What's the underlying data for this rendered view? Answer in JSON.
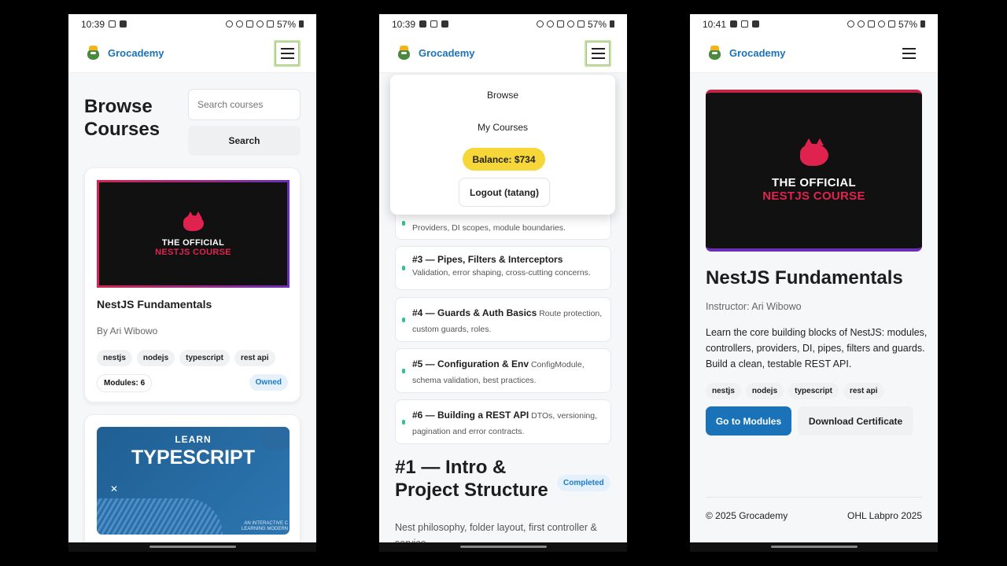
{
  "screens": [
    {
      "status": {
        "time": "10:39",
        "battery": "57%"
      },
      "header": {
        "brand": "Grocademy"
      },
      "browse": {
        "title": "Browse Courses",
        "search_placeholder": "Search courses",
        "search_button": "Search"
      },
      "courses": [
        {
          "thumb_line1": "THE OFFICIAL",
          "thumb_line2": "NESTJS COURSE",
          "title": "NestJS Fundamentals",
          "author": "By Ari Wibowo",
          "tags": [
            "nestjs",
            "nodejs",
            "typescript",
            "rest api"
          ],
          "modules": "Modules: 6",
          "status": "Owned"
        },
        {
          "thumb_line1": "LEARN",
          "thumb_line2": "TYPESCRIPT",
          "thumb_caption": "AN INTERACTIVE C LEARNING MODERN"
        }
      ]
    },
    {
      "status": {
        "time": "10:39",
        "battery": "57%"
      },
      "header": {
        "brand": "Grocademy"
      },
      "menu": {
        "browse": "Browse",
        "my_courses": "My Courses",
        "balance": "Balance: $734",
        "logout": "Logout (tatang)"
      },
      "modules": [
        {
          "title": "",
          "desc": "Providers, DI scopes, module boundaries."
        },
        {
          "title": "#3 — Pipes, Filters & Interceptors",
          "desc": "Validation, error shaping, cross-cutting concerns."
        },
        {
          "title": "#4 — Guards & Auth Basics",
          "desc": "Route protection, custom guards, roles."
        },
        {
          "title": "#5 — Configuration & Env",
          "desc": "ConfigModule, schema validation, best practices."
        },
        {
          "title": "#6 — Building a REST API",
          "desc": "DTOs, versioning, pagination and error contracts."
        }
      ],
      "section": {
        "title": "#1 — Intro & Project Structure",
        "badge": "Completed",
        "desc": "Nest philosophy, folder layout, first controller & service."
      }
    },
    {
      "status": {
        "time": "10:41",
        "battery": "57%"
      },
      "header": {
        "brand": "Grocademy"
      },
      "course": {
        "thumb_line1": "THE OFFICIAL",
        "thumb_line2": "NESTJS COURSE",
        "title": "NestJS Fundamentals",
        "instructor": "Instructor: Ari Wibowo",
        "description": "Learn the core building blocks of NestJS: modules, controllers, providers, DI, pipes, filters and guards. Build a clean, testable REST API.",
        "tags": [
          "nestjs",
          "nodejs",
          "typescript",
          "rest api"
        ],
        "primary_button": "Go to Modules",
        "secondary_button": "Download Certificate"
      },
      "footer": {
        "left": "© 2025 Grocademy",
        "right": "OHL Labpro 2025"
      }
    }
  ]
}
